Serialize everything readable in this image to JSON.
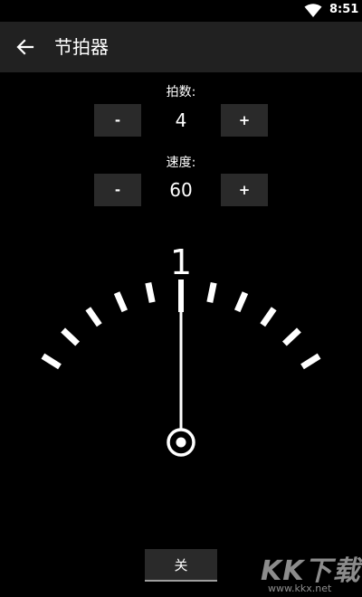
{
  "status_bar": {
    "time": "8:51",
    "wifi_icon": "wifi-icon"
  },
  "app_bar": {
    "back_icon": "arrow-back-icon",
    "title": "节拍器"
  },
  "beats": {
    "label": "拍数:",
    "decrement_label": "-",
    "value": "4",
    "increment_label": "+"
  },
  "tempo": {
    "label": "速度:",
    "decrement_label": "-",
    "value": "60",
    "increment_label": "+"
  },
  "indicator": {
    "current_beat": "1",
    "pendulum_position": 0
  },
  "toggle": {
    "label": "关"
  },
  "watermark": {
    "logo": "KK下载",
    "url": "www.kkx.net"
  }
}
